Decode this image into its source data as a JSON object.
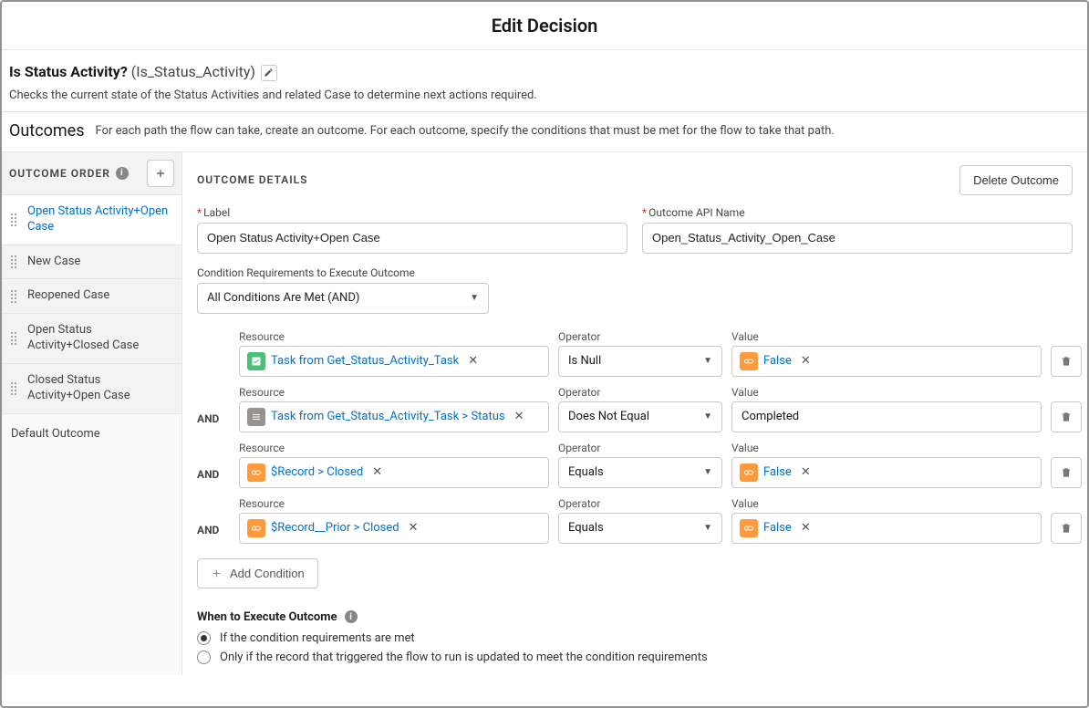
{
  "title": "Edit Decision",
  "decision": {
    "label": "Is Status Activity?",
    "api": "(Is_Status_Activity)",
    "description": "Checks the current state of the Status Activities and related Case to determine next actions required."
  },
  "outcomes_section": {
    "heading": "Outcomes",
    "help": "For each path the flow can take, create an outcome. For each outcome, specify the conditions that must be met for the flow to take that path."
  },
  "left": {
    "header": "OUTCOME ORDER",
    "items": [
      {
        "label": "Open Status Activity+Open Case",
        "selected": true
      },
      {
        "label": "New Case",
        "selected": false
      },
      {
        "label": "Reopened Case",
        "selected": false
      },
      {
        "label": "Open Status Activity+Closed Case",
        "selected": false
      },
      {
        "label": "Closed Status Activity+Open Case",
        "selected": false
      }
    ],
    "default_label": "Default Outcome"
  },
  "details": {
    "header": "OUTCOME DETAILS",
    "delete_button": "Delete Outcome",
    "label_field_label": "Label",
    "api_field_label": "Outcome API Name",
    "label_value": "Open Status Activity+Open Case",
    "api_value": "Open_Status_Activity_Open_Case",
    "cond_req_label": "Condition Requirements to Execute Outcome",
    "cond_req_value": "All Conditions Are Met (AND)",
    "col_labels": {
      "resource": "Resource",
      "operator": "Operator",
      "value": "Value"
    },
    "and_text": "AND",
    "rows": [
      {
        "and": false,
        "resource": {
          "icon": "ic-task",
          "text": "Task from Get_Status_Activity_Task"
        },
        "operator": "Is Null",
        "value": {
          "type": "pill",
          "icon": "ic-link",
          "text": "False"
        }
      },
      {
        "and": true,
        "resource": {
          "icon": "ic-field",
          "text": "Task from Get_Status_Activity_Task > Status"
        },
        "operator": "Does Not Equal",
        "value": {
          "type": "text",
          "text": "Completed"
        }
      },
      {
        "and": true,
        "resource": {
          "icon": "ic-link",
          "text": "$Record > Closed"
        },
        "operator": "Equals",
        "value": {
          "type": "pill",
          "icon": "ic-link",
          "text": "False"
        }
      },
      {
        "and": true,
        "resource": {
          "icon": "ic-link",
          "text": "$Record__Prior > Closed"
        },
        "operator": "Equals",
        "value": {
          "type": "pill",
          "icon": "ic-link",
          "text": "False"
        }
      }
    ],
    "add_condition": "Add Condition",
    "execute": {
      "heading": "When to Execute Outcome",
      "options": [
        {
          "label": "If the condition requirements are met",
          "checked": true
        },
        {
          "label": "Only if the record that triggered the flow to run is updated to meet the condition requirements",
          "checked": false
        }
      ]
    }
  }
}
